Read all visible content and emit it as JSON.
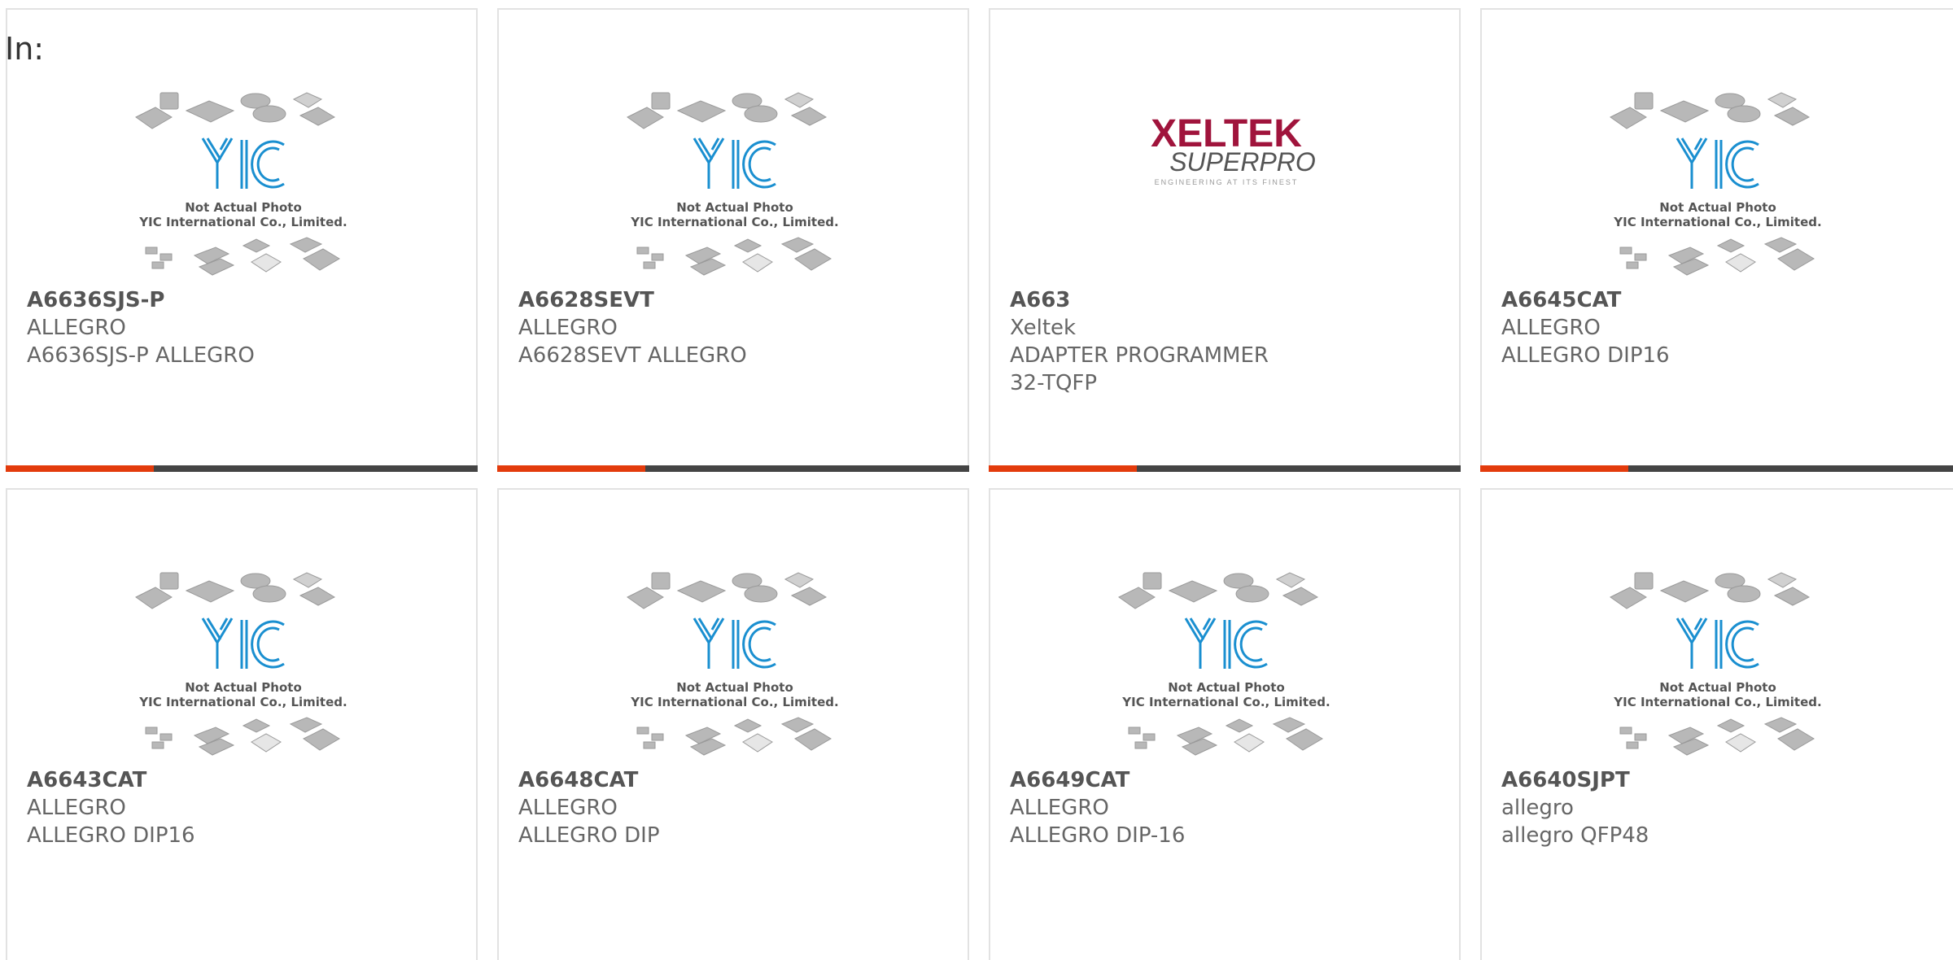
{
  "page": {
    "in_label": "In:"
  },
  "colors": {
    "accent": "#e33b0c",
    "bar": "#444444",
    "border": "#e2e2e2",
    "logo_blue": "#1a8fd0",
    "xeltek_red": "#a0143c"
  },
  "placeholder": {
    "line1": "Not Actual Photo",
    "line2": "YIC International Co., Limited.",
    "logo_text": "YIC"
  },
  "xeltek_logo": {
    "brand": "XELTEK",
    "product": "SUPERPRO",
    "tagline": "ENGINEERING AT ITS FINEST"
  },
  "cards": [
    {
      "part": "A6636SJS-P",
      "manufacturer": "ALLEGRO",
      "description": "A6636SJS-P ALLEGRO",
      "image": "yic-placeholder"
    },
    {
      "part": "A6628SEVT",
      "manufacturer": "ALLEGRO",
      "description": "A6628SEVT ALLEGRO",
      "image": "yic-placeholder"
    },
    {
      "part": "A663",
      "manufacturer": "Xeltek",
      "description": "ADAPTER PROGRAMMER 32-TQFP",
      "image": "xeltek-logo"
    },
    {
      "part": "A6645CAT",
      "manufacturer": "ALLEGRO",
      "description": "ALLEGRO DIP16",
      "image": "yic-placeholder"
    },
    {
      "part": "A6643CAT",
      "manufacturer": "ALLEGRO",
      "description": "ALLEGRO DIP16",
      "image": "yic-placeholder"
    },
    {
      "part": "A6648CAT",
      "manufacturer": "ALLEGRO",
      "description": "ALLEGRO DIP",
      "image": "yic-placeholder"
    },
    {
      "part": "A6649CAT",
      "manufacturer": "ALLEGRO",
      "description": "ALLEGRO DIP-16",
      "image": "yic-placeholder"
    },
    {
      "part": "A6640SJPT",
      "manufacturer": "allegro",
      "description": "allegro QFP48",
      "image": "yic-placeholder"
    }
  ]
}
